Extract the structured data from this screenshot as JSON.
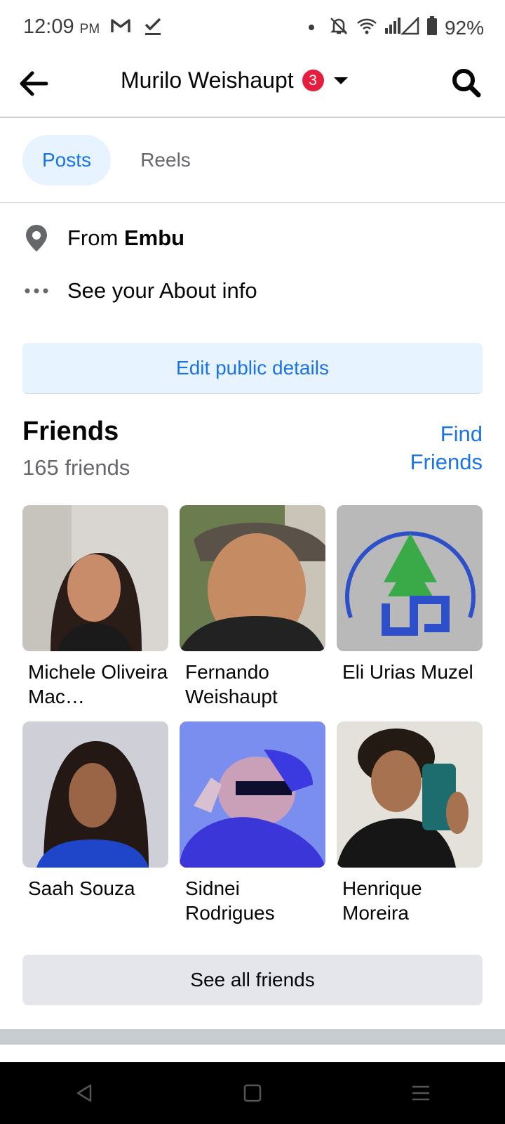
{
  "status_bar": {
    "time": "12:09",
    "ampm": "PM",
    "battery": "92%",
    "left_icons": [
      "gmail-icon",
      "check-icon"
    ],
    "right_icons": [
      "dot-icon",
      "bell-off-icon",
      "wifi-icon",
      "signal-icon",
      "battery-icon"
    ]
  },
  "header": {
    "title": "Murilo Weishaupt",
    "badge_count": "3"
  },
  "tabs": [
    {
      "label": "Posts",
      "active": true
    },
    {
      "label": "Reels",
      "active": false
    }
  ],
  "about": {
    "from_prefix": "From",
    "from_place": "Embu",
    "about_link": "See your About info"
  },
  "edit_button": "Edit public details",
  "friends": {
    "title": "Friends",
    "count": "165 friends",
    "find_link": "Find Friends",
    "items": [
      {
        "name": "Michele Oliveira Mac…"
      },
      {
        "name": "Fernando Weishaupt"
      },
      {
        "name": "Eli Urias Muzel"
      },
      {
        "name": "Saah Souza"
      },
      {
        "name": "Sidnei Rodrigues"
      },
      {
        "name": "Henrique Moreira"
      }
    ],
    "see_all": "See all friends"
  },
  "colors": {
    "accent": "#1b74e4",
    "accent_bg": "#e7f3ff",
    "badge": "#e41e3f",
    "secondary_text": "#65676b"
  }
}
